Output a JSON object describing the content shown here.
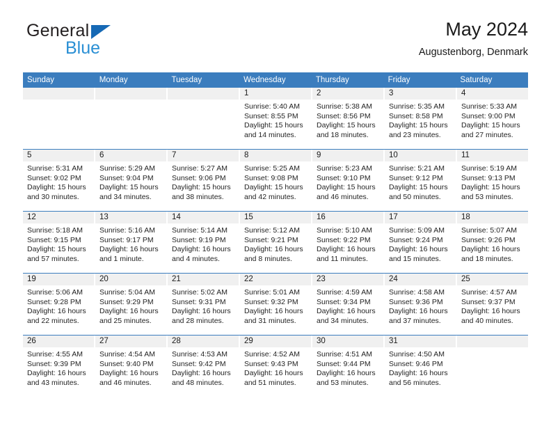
{
  "brand": {
    "name_part1": "General",
    "name_part2": "Blue",
    "triangle_color": "#1669b5",
    "blue_text_color": "#2a8fd4"
  },
  "header": {
    "title": "May 2024",
    "subtitle": "Augustenborg, Denmark"
  },
  "colors": {
    "header_blue": "#3b7dbe",
    "day_band_gray": "#f0f0f0",
    "text": "#1a1a1a"
  },
  "weekdays": [
    "Sunday",
    "Monday",
    "Tuesday",
    "Wednesday",
    "Thursday",
    "Friday",
    "Saturday"
  ],
  "weeks": [
    [
      {
        "day": "",
        "sunrise": "",
        "sunset": "",
        "daylight": "",
        "empty": true
      },
      {
        "day": "",
        "sunrise": "",
        "sunset": "",
        "daylight": "",
        "empty": true
      },
      {
        "day": "",
        "sunrise": "",
        "sunset": "",
        "daylight": "",
        "empty": true
      },
      {
        "day": "1",
        "sunrise": "Sunrise: 5:40 AM",
        "sunset": "Sunset: 8:55 PM",
        "daylight": "Daylight: 15 hours and 14 minutes."
      },
      {
        "day": "2",
        "sunrise": "Sunrise: 5:38 AM",
        "sunset": "Sunset: 8:56 PM",
        "daylight": "Daylight: 15 hours and 18 minutes."
      },
      {
        "day": "3",
        "sunrise": "Sunrise: 5:35 AM",
        "sunset": "Sunset: 8:58 PM",
        "daylight": "Daylight: 15 hours and 23 minutes."
      },
      {
        "day": "4",
        "sunrise": "Sunrise: 5:33 AM",
        "sunset": "Sunset: 9:00 PM",
        "daylight": "Daylight: 15 hours and 27 minutes."
      }
    ],
    [
      {
        "day": "5",
        "sunrise": "Sunrise: 5:31 AM",
        "sunset": "Sunset: 9:02 PM",
        "daylight": "Daylight: 15 hours and 30 minutes."
      },
      {
        "day": "6",
        "sunrise": "Sunrise: 5:29 AM",
        "sunset": "Sunset: 9:04 PM",
        "daylight": "Daylight: 15 hours and 34 minutes."
      },
      {
        "day": "7",
        "sunrise": "Sunrise: 5:27 AM",
        "sunset": "Sunset: 9:06 PM",
        "daylight": "Daylight: 15 hours and 38 minutes."
      },
      {
        "day": "8",
        "sunrise": "Sunrise: 5:25 AM",
        "sunset": "Sunset: 9:08 PM",
        "daylight": "Daylight: 15 hours and 42 minutes."
      },
      {
        "day": "9",
        "sunrise": "Sunrise: 5:23 AM",
        "sunset": "Sunset: 9:10 PM",
        "daylight": "Daylight: 15 hours and 46 minutes."
      },
      {
        "day": "10",
        "sunrise": "Sunrise: 5:21 AM",
        "sunset": "Sunset: 9:12 PM",
        "daylight": "Daylight: 15 hours and 50 minutes."
      },
      {
        "day": "11",
        "sunrise": "Sunrise: 5:19 AM",
        "sunset": "Sunset: 9:13 PM",
        "daylight": "Daylight: 15 hours and 53 minutes."
      }
    ],
    [
      {
        "day": "12",
        "sunrise": "Sunrise: 5:18 AM",
        "sunset": "Sunset: 9:15 PM",
        "daylight": "Daylight: 15 hours and 57 minutes."
      },
      {
        "day": "13",
        "sunrise": "Sunrise: 5:16 AM",
        "sunset": "Sunset: 9:17 PM",
        "daylight": "Daylight: 16 hours and 1 minute."
      },
      {
        "day": "14",
        "sunrise": "Sunrise: 5:14 AM",
        "sunset": "Sunset: 9:19 PM",
        "daylight": "Daylight: 16 hours and 4 minutes."
      },
      {
        "day": "15",
        "sunrise": "Sunrise: 5:12 AM",
        "sunset": "Sunset: 9:21 PM",
        "daylight": "Daylight: 16 hours and 8 minutes."
      },
      {
        "day": "16",
        "sunrise": "Sunrise: 5:10 AM",
        "sunset": "Sunset: 9:22 PM",
        "daylight": "Daylight: 16 hours and 11 minutes."
      },
      {
        "day": "17",
        "sunrise": "Sunrise: 5:09 AM",
        "sunset": "Sunset: 9:24 PM",
        "daylight": "Daylight: 16 hours and 15 minutes."
      },
      {
        "day": "18",
        "sunrise": "Sunrise: 5:07 AM",
        "sunset": "Sunset: 9:26 PM",
        "daylight": "Daylight: 16 hours and 18 minutes."
      }
    ],
    [
      {
        "day": "19",
        "sunrise": "Sunrise: 5:06 AM",
        "sunset": "Sunset: 9:28 PM",
        "daylight": "Daylight: 16 hours and 22 minutes."
      },
      {
        "day": "20",
        "sunrise": "Sunrise: 5:04 AM",
        "sunset": "Sunset: 9:29 PM",
        "daylight": "Daylight: 16 hours and 25 minutes."
      },
      {
        "day": "21",
        "sunrise": "Sunrise: 5:02 AM",
        "sunset": "Sunset: 9:31 PM",
        "daylight": "Daylight: 16 hours and 28 minutes."
      },
      {
        "day": "22",
        "sunrise": "Sunrise: 5:01 AM",
        "sunset": "Sunset: 9:32 PM",
        "daylight": "Daylight: 16 hours and 31 minutes."
      },
      {
        "day": "23",
        "sunrise": "Sunrise: 4:59 AM",
        "sunset": "Sunset: 9:34 PM",
        "daylight": "Daylight: 16 hours and 34 minutes."
      },
      {
        "day": "24",
        "sunrise": "Sunrise: 4:58 AM",
        "sunset": "Sunset: 9:36 PM",
        "daylight": "Daylight: 16 hours and 37 minutes."
      },
      {
        "day": "25",
        "sunrise": "Sunrise: 4:57 AM",
        "sunset": "Sunset: 9:37 PM",
        "daylight": "Daylight: 16 hours and 40 minutes."
      }
    ],
    [
      {
        "day": "26",
        "sunrise": "Sunrise: 4:55 AM",
        "sunset": "Sunset: 9:39 PM",
        "daylight": "Daylight: 16 hours and 43 minutes."
      },
      {
        "day": "27",
        "sunrise": "Sunrise: 4:54 AM",
        "sunset": "Sunset: 9:40 PM",
        "daylight": "Daylight: 16 hours and 46 minutes."
      },
      {
        "day": "28",
        "sunrise": "Sunrise: 4:53 AM",
        "sunset": "Sunset: 9:42 PM",
        "daylight": "Daylight: 16 hours and 48 minutes."
      },
      {
        "day": "29",
        "sunrise": "Sunrise: 4:52 AM",
        "sunset": "Sunset: 9:43 PM",
        "daylight": "Daylight: 16 hours and 51 minutes."
      },
      {
        "day": "30",
        "sunrise": "Sunrise: 4:51 AM",
        "sunset": "Sunset: 9:44 PM",
        "daylight": "Daylight: 16 hours and 53 minutes."
      },
      {
        "day": "31",
        "sunrise": "Sunrise: 4:50 AM",
        "sunset": "Sunset: 9:46 PM",
        "daylight": "Daylight: 16 hours and 56 minutes."
      },
      {
        "day": "",
        "sunrise": "",
        "sunset": "",
        "daylight": "",
        "empty": true
      }
    ]
  ]
}
